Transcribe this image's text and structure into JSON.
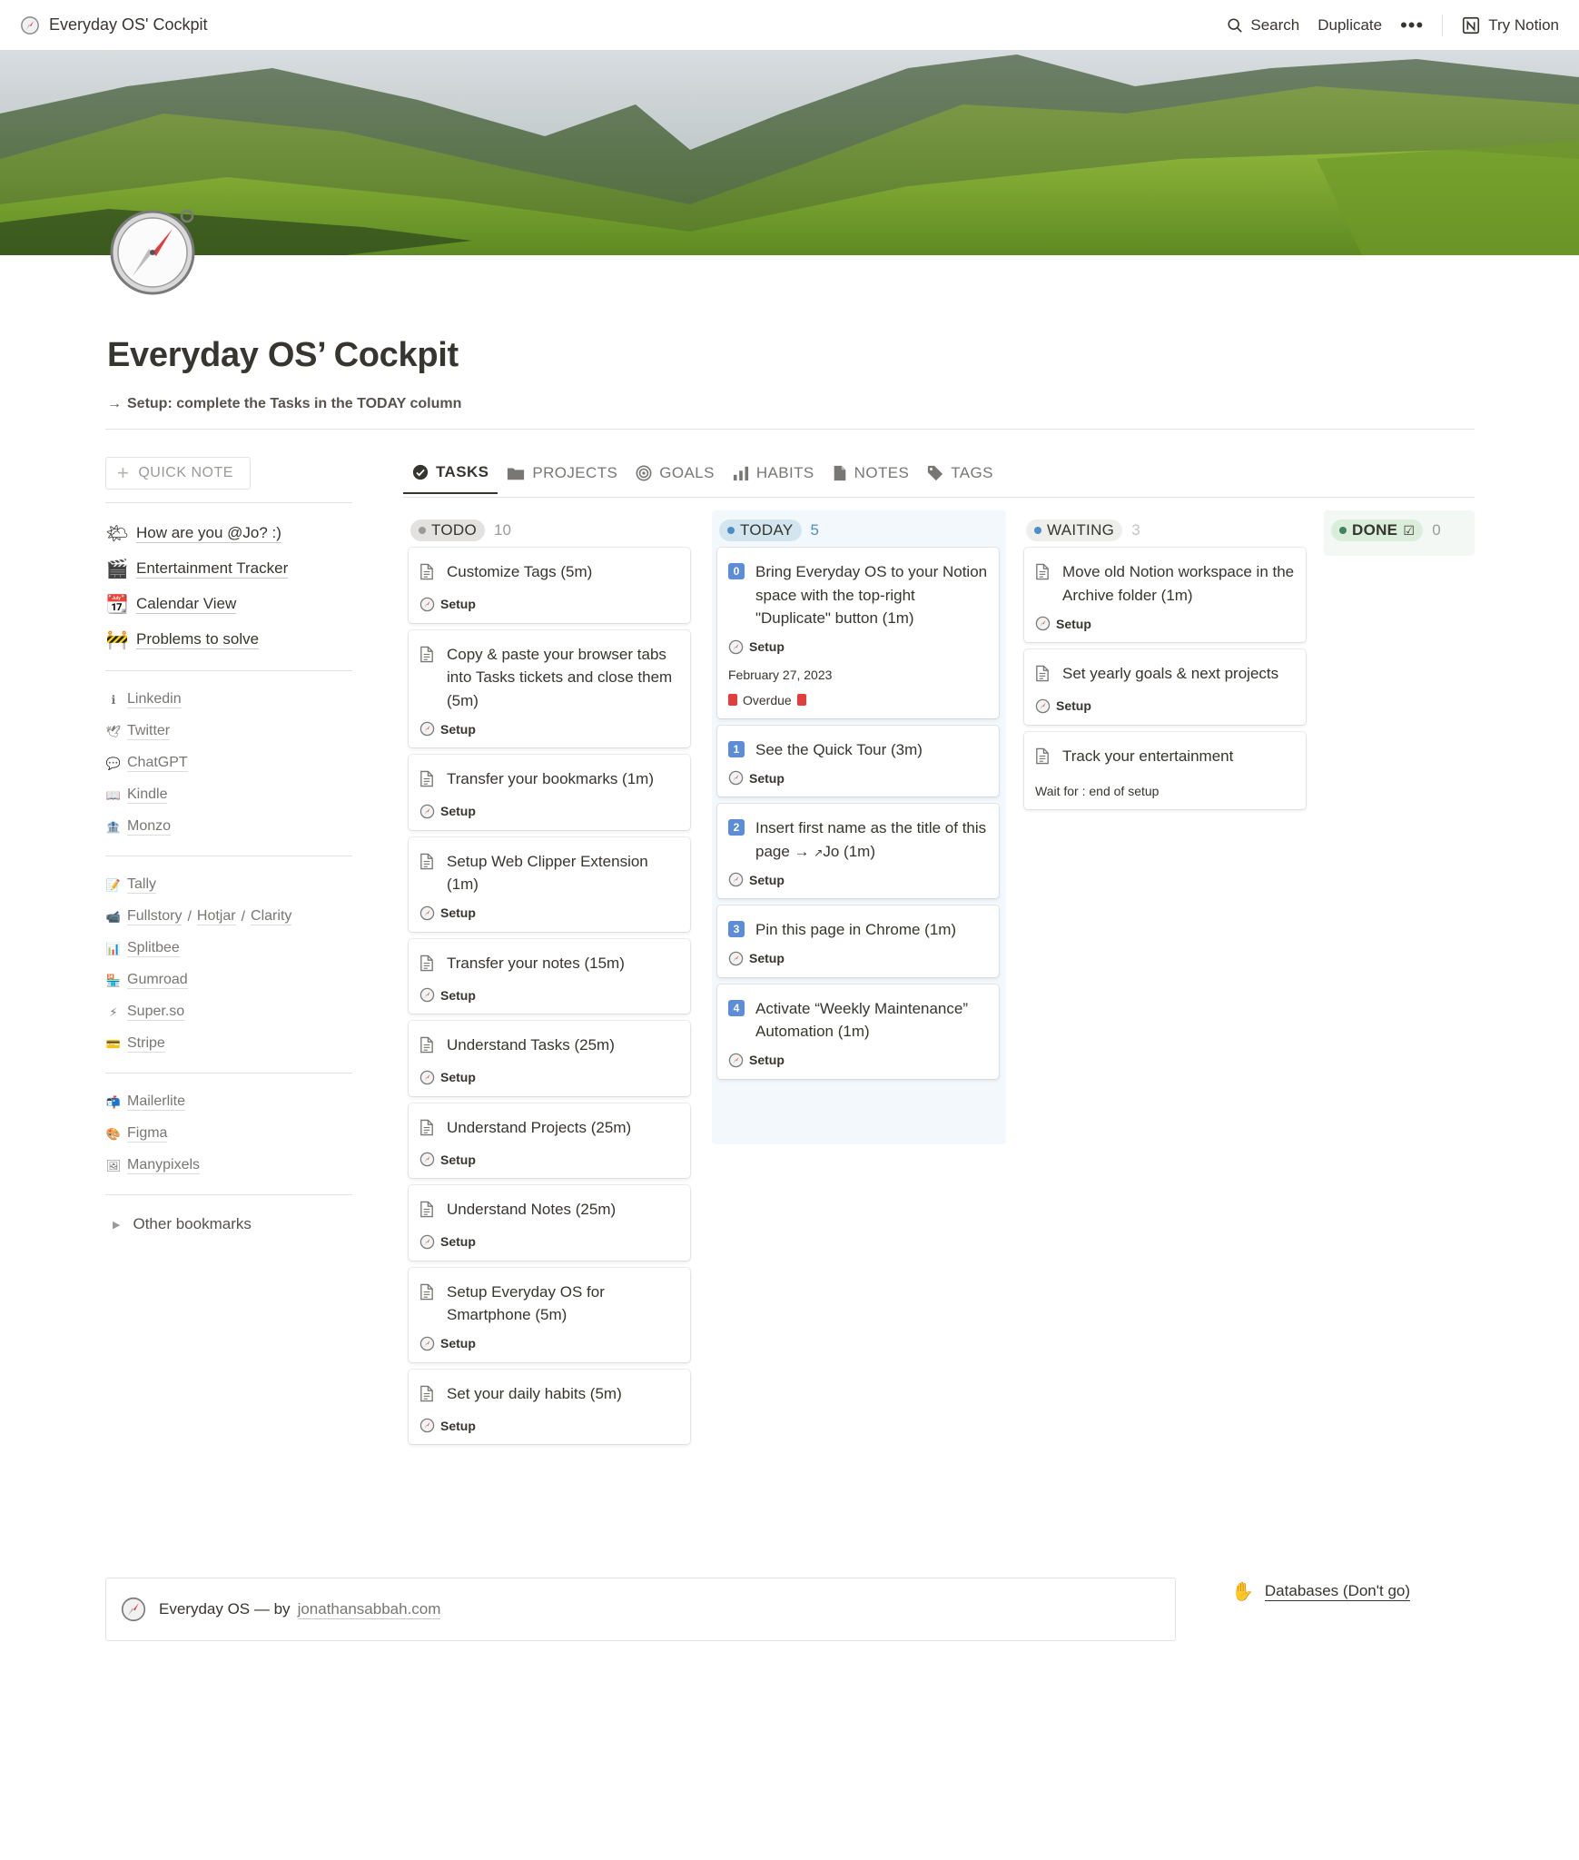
{
  "topbar": {
    "breadcrumb": "Everyday OS' Cockpit",
    "search": "Search",
    "duplicate": "Duplicate",
    "more": "•••",
    "try_notion": "Try Notion"
  },
  "page": {
    "title": "Everyday OS’ Cockpit",
    "subtitle_arrow": "→",
    "subtitle": "Setup: complete the Tasks in the TODAY column"
  },
  "sidebar": {
    "quick_note": "QUICK NOTE",
    "primary": [
      {
        "emoji": "🌤",
        "label": "How are you @Jo? :)"
      },
      {
        "emoji": "🎬",
        "label": "Entertainment Tracker"
      },
      {
        "emoji": "📆",
        "label": "Calendar View"
      },
      {
        "emoji": "🚧",
        "label": "Problems to solve"
      }
    ],
    "group1": [
      {
        "emoji": "ℹ",
        "label": "Linkedin"
      },
      {
        "emoji": "🕊",
        "label": "Twitter"
      },
      {
        "emoji": "💬",
        "label": "ChatGPT"
      },
      {
        "emoji": "📖",
        "label": "Kindle"
      },
      {
        "emoji": "🏦",
        "label": "Monzo"
      }
    ],
    "group2": [
      {
        "emoji": "📝",
        "label": "Tally"
      },
      {
        "emoji": "📹",
        "label": "Fullstory",
        "extra": [
          "Hotjar",
          "Clarity"
        ]
      },
      {
        "emoji": "📊",
        "label": "Splitbee"
      },
      {
        "emoji": "🏪",
        "label": "Gumroad"
      },
      {
        "emoji": "⚡",
        "label": "Super.so"
      },
      {
        "emoji": "💳",
        "label": "Stripe"
      }
    ],
    "group3": [
      {
        "emoji": "📬",
        "label": "Mailerlite"
      },
      {
        "emoji": "🎨",
        "label": "Figma"
      },
      {
        "emoji": "🖼",
        "label": "Manypixels"
      }
    ],
    "other": "Other bookmarks"
  },
  "tabs": [
    "TASKS",
    "PROJECTS",
    "GOALS",
    "HABITS",
    "NOTES",
    "TAGS"
  ],
  "board": {
    "todo": {
      "label": "TODO",
      "count": "10",
      "cards": [
        {
          "title": "Customize Tags (5m)",
          "tag": "Setup"
        },
        {
          "title": "Copy & paste your browser tabs into Tasks tickets and close them (5m)",
          "tag": "Setup"
        },
        {
          "title": "Transfer your bookmarks (1m)",
          "tag": "Setup"
        },
        {
          "title": "Setup Web Clipper Extension (1m)",
          "tag": "Setup"
        },
        {
          "title": "Transfer your notes (15m)",
          "tag": "Setup"
        },
        {
          "title": "Understand Tasks (25m)",
          "tag": "Setup"
        },
        {
          "title": "Understand Projects (25m)",
          "tag": "Setup"
        },
        {
          "title": "Understand Notes (25m)",
          "tag": "Setup"
        },
        {
          "title": "Setup Everyday OS for Smartphone (5m)",
          "tag": "Setup"
        },
        {
          "title": "Set your daily habits (5m)",
          "tag": "Setup"
        }
      ]
    },
    "today": {
      "label": "TODAY",
      "count": "5",
      "cards": [
        {
          "num": "0",
          "title": "Bring Everyday OS to your Notion space with the top-right \"Duplicate\" button (1m)",
          "tag": "Setup",
          "date": "February 27, 2023",
          "overdue": "Overdue"
        },
        {
          "num": "1",
          "title": "See the Quick Tour (3m)",
          "tag": "Setup"
        },
        {
          "num": "2",
          "title_a": "Insert first name as the title of this page →",
          "title_link": "Jo",
          "title_b": "(1m)",
          "tag": "Setup"
        },
        {
          "num": "3",
          "title": "Pin this page in Chrome (1m)",
          "tag": "Setup"
        },
        {
          "num": "4",
          "title": "Activate “Weekly Maintenance” Automation (1m)",
          "tag": "Setup"
        }
      ]
    },
    "waiting": {
      "label": "WAITING",
      "count": "3",
      "cards": [
        {
          "title": "Move old Notion workspace in the Archive folder (1m)",
          "tag": "Setup"
        },
        {
          "title": "Set yearly goals & next projects",
          "tag": "Setup"
        },
        {
          "title": "Track your entertainment",
          "wait": "Wait for : end of setup"
        }
      ]
    },
    "done": {
      "label": "DONE",
      "count": "0"
    }
  },
  "footer": {
    "text": "Everyday OS — by",
    "link": "jonathansabbah.com",
    "databases": "Databases (Don't go)"
  },
  "colors": {
    "todo_pill": "#e3e2e0",
    "today_pill": "#d3e5ef",
    "waiting_pill": "#eeeeed",
    "done_pill": "#dbeddb",
    "today_num": "#5d8dd6",
    "overdue": "#e03e3e"
  }
}
